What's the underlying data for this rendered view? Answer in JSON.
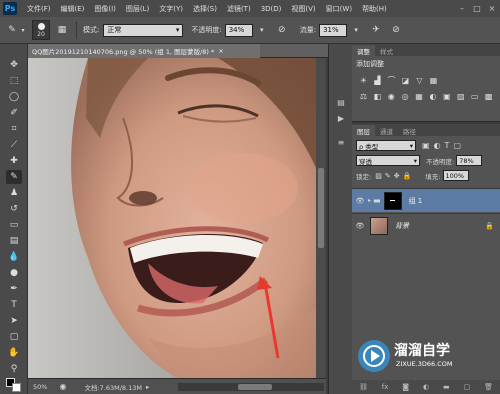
{
  "app": {
    "logo": "Ps"
  },
  "menu": [
    "文件(F)",
    "编辑(E)",
    "图像(I)",
    "图层(L)",
    "文字(Y)",
    "选择(S)",
    "滤镜(T)",
    "3D(D)",
    "视图(V)",
    "窗口(W)",
    "帮助(H)"
  ],
  "options": {
    "brush_size": "20",
    "mode_label": "模式:",
    "mode_value": "正常",
    "opacity_label": "不透明度:",
    "opacity_value": "34%",
    "flow_label": "流量:",
    "flow_value": "31%"
  },
  "document": {
    "tab_title": "QQ图片20191210140706.png @ 50% (组 1, 图层蒙版/8) *",
    "tab_close": "×",
    "zoom": "50%",
    "doc_info": "文档:7.63M/8.13M"
  },
  "adjustments": {
    "tabs": [
      "调整",
      "样式"
    ],
    "title": "添加调整"
  },
  "layers_panel": {
    "tabs": [
      "图层",
      "通道",
      "路径"
    ],
    "filter_type": "ρ 类型",
    "blend_mode": "穿透",
    "opacity_label": "不透明度:",
    "opacity_value": "78%",
    "lock_label": "锁定:",
    "fill_label": "填充:",
    "fill_value": "100%",
    "layers": [
      {
        "name": "组 1",
        "selected": true
      },
      {
        "name": "背景",
        "selected": false
      }
    ]
  },
  "watermark": {
    "title": "溜溜自学",
    "url": "ZIXUE.3D66.COM"
  },
  "colors": {
    "accent": "#5c7ca6",
    "arrow": "#e8392f",
    "watermark_bg": "#3a86b8"
  }
}
